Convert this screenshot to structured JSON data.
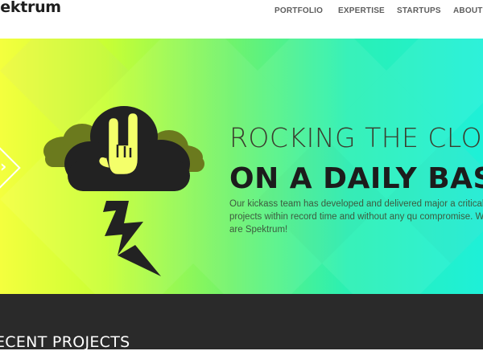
{
  "header": {
    "logo_text": "pektrum",
    "nav": [
      {
        "label": "PORTFOLIO"
      },
      {
        "label": "EXPERTISE"
      },
      {
        "label": "STARTUPS"
      },
      {
        "label": "ABOUT"
      }
    ]
  },
  "hero": {
    "title_line1": "ROCKING THE CLOU",
    "title_line2": "ON A DAILY BAS",
    "description": "Our kickass team has developed and delivered major a critical projects within record time and without any qu compromise. We are Spektrum!",
    "prev_arrow_icon": "chevron-left-icon",
    "illustration_icons": [
      "cloud-icon",
      "rock-hand-icon",
      "lightning-icon"
    ],
    "colors": {
      "gradient_start": "#f4ff3e",
      "gradient_end": "#1ef0d8",
      "cloud_dark": "#222222",
      "cloud_olive": "#6b7a1e"
    }
  },
  "projects": {
    "title": "ECENT PROJECTS",
    "background": "#2a2a2a"
  }
}
